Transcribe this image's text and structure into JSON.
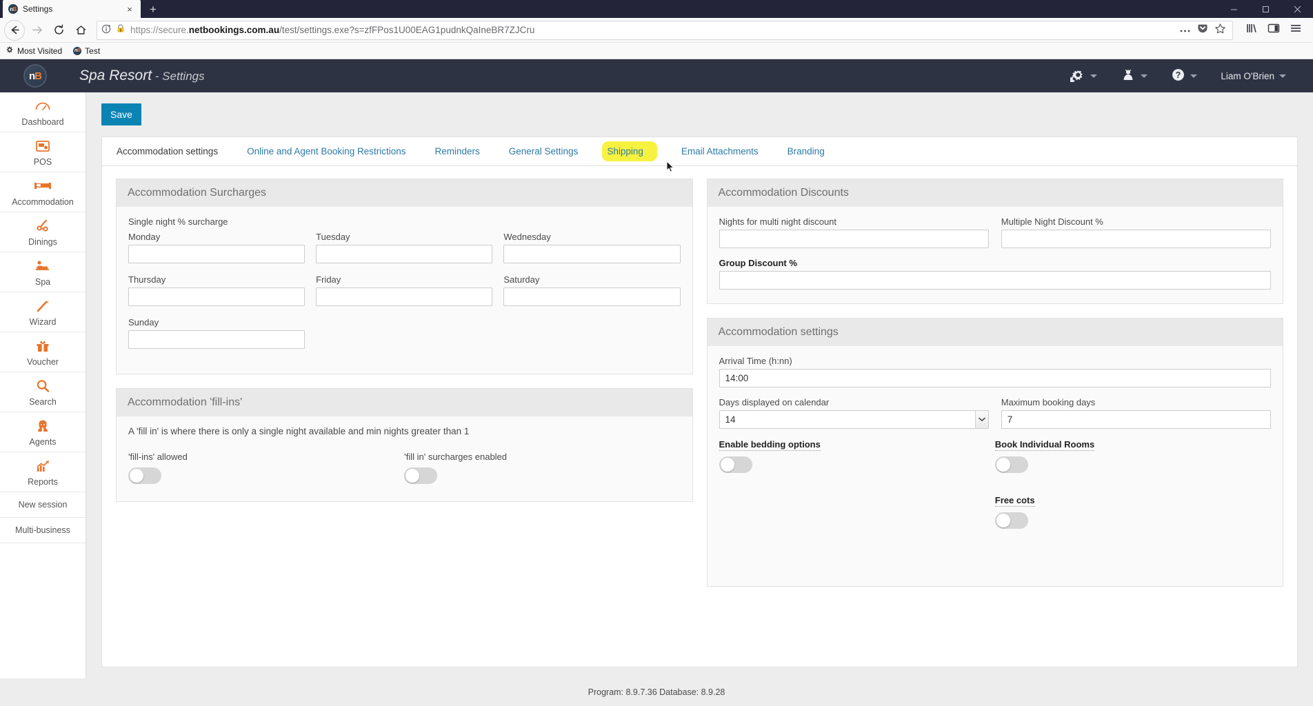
{
  "browser": {
    "tab_title": "Settings",
    "tab_favicon": "nb-logo-icon",
    "new_tab_label": "+",
    "close_tab_label": "×",
    "url_scheme": "https://secure.",
    "url_domain": "netbookings.com.au",
    "url_path": "/test/settings.exe?s=zfFPos1U00EAG1pudnkQaIneBR7ZJCru",
    "bookmarks": [
      {
        "label": "Most Visited",
        "icon": "star-gear-icon"
      },
      {
        "label": "Test",
        "icon": "nb-logo-icon"
      }
    ],
    "window_controls": [
      "minimize",
      "maximize",
      "close"
    ]
  },
  "header": {
    "logo_n": "n",
    "logo_b": "B",
    "business": "Spa Resort",
    "separator": " - ",
    "page": "Settings",
    "user": "Liam O'Brien",
    "icons": [
      "gears-icon",
      "agent-person-icon",
      "help-question-icon"
    ]
  },
  "sidebar": {
    "items": [
      {
        "label": "Dashboard",
        "icon": "gauge-icon"
      },
      {
        "label": "POS",
        "icon": "pos-terminal-icon"
      },
      {
        "label": "Accommodation",
        "icon": "bed-icon"
      },
      {
        "label": "Dinings",
        "icon": "cutlery-icon"
      },
      {
        "label": "Spa",
        "icon": "massage-icon"
      },
      {
        "label": "Wizard",
        "icon": "magic-wand-icon"
      },
      {
        "label": "Voucher",
        "icon": "gift-icon"
      },
      {
        "label": "Search",
        "icon": "search-icon"
      },
      {
        "label": "Agents",
        "icon": "agent-icon"
      },
      {
        "label": "Reports",
        "icon": "chart-growth-icon"
      }
    ],
    "plain_items": [
      {
        "label": "New session"
      },
      {
        "label": "Multi-business"
      }
    ]
  },
  "toolbar": {
    "save_label": "Save"
  },
  "tabs": [
    {
      "label": "Accommodation settings",
      "active": true
    },
    {
      "label": "Online and Agent Booking Restrictions",
      "active": false
    },
    {
      "label": "Reminders",
      "active": false
    },
    {
      "label": "General Settings",
      "active": false
    },
    {
      "label": "Shipping",
      "active": false,
      "highlighted": true
    },
    {
      "label": "Email Attachments",
      "active": false
    },
    {
      "label": "Branding",
      "active": false
    }
  ],
  "surcharges": {
    "title": "Accommodation Surcharges",
    "note": "Single night % surcharge",
    "days": [
      {
        "label": "Monday",
        "value": ""
      },
      {
        "label": "Tuesday",
        "value": ""
      },
      {
        "label": "Wednesday",
        "value": ""
      },
      {
        "label": "Thursday",
        "value": ""
      },
      {
        "label": "Friday",
        "value": ""
      },
      {
        "label": "Saturday",
        "value": ""
      },
      {
        "label": "Sunday",
        "value": ""
      }
    ]
  },
  "fillins": {
    "title": "Accommodation 'fill-ins'",
    "description": "A 'fill in' is where there is only a single night available and min nights greater than 1",
    "toggles": [
      {
        "label": "'fill-ins' allowed",
        "on": false
      },
      {
        "label": "'fill in' surcharges enabled",
        "on": false
      }
    ]
  },
  "discounts": {
    "title": "Accommodation Discounts",
    "nights_label": "Nights for multi night discount",
    "nights_value": "",
    "multi_label": "Multiple Night Discount %",
    "multi_value": "",
    "group_label": "Group Discount %",
    "group_value": ""
  },
  "accom_settings": {
    "title": "Accommodation settings",
    "arrival_label": "Arrival Time (h:nn)",
    "arrival_value": "14:00",
    "days_label": "Days displayed on calendar",
    "days_value": "14",
    "days_options": [
      "14"
    ],
    "max_label": "Maximum booking days",
    "max_value": "7",
    "bedding_label": "Enable bedding options",
    "bedding_on": false,
    "rooms_label": "Book Individual Rooms",
    "rooms_on": false,
    "cots_label": "Free cots",
    "cots_on": false
  },
  "footer": {
    "text": "Program: 8.9.7.36 Database: 8.9.28"
  },
  "colors": {
    "header_bg": "#2e3344",
    "accent_orange": "#e8742c",
    "save_blue": "#0b84b4",
    "link_blue": "#2d7aa8",
    "highlight_yellow": "#f7f240"
  }
}
